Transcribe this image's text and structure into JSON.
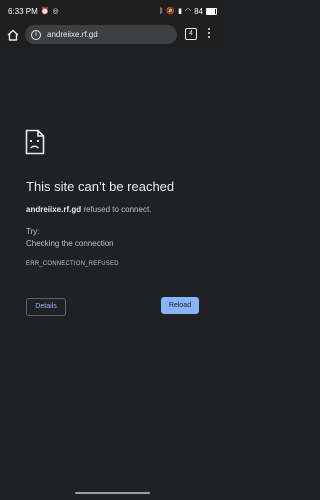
{
  "status_bar": {
    "time": "6:33 PM",
    "battery": "84"
  },
  "toolbar": {
    "url": "andreiixe.rf.gd",
    "tab_count": "4"
  },
  "error_page": {
    "title": "This site can’t be reached",
    "host": "andreiixe.rf.gd",
    "refused_suffix": " refused to connect.",
    "try_label": "Try:",
    "suggestion": "Checking the connection",
    "error_code": "ERR_CONNECTION_REFUSED",
    "details_label": "Details",
    "reload_label": "Reload"
  },
  "colors": {
    "background": "#202124",
    "accent": "#8ab4f8"
  }
}
